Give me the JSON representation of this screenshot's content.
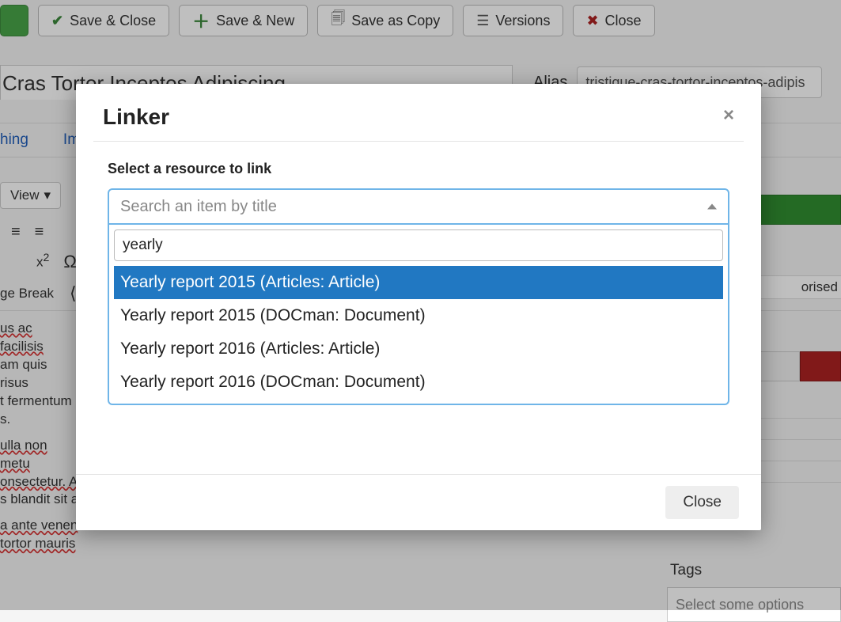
{
  "toolbar": {
    "save_close": "Save & Close",
    "save_new": "Save & New",
    "save_copy": "Save as Copy",
    "versions": "Versions",
    "close": "Close"
  },
  "title_row": {
    "title_value": "Cras Tortor Inceptos Adipiscing",
    "alias_label": "Alias",
    "alias_value": "tristique-cras-tortor-inceptos-adipis"
  },
  "tabs": {
    "partial1": "hing",
    "partial2": "Ima"
  },
  "editor": {
    "view_label": "View",
    "pagebreak": "ge Break",
    "view_caret": "▾"
  },
  "body_text": {
    "p1a": "us ac facilisis",
    "p1b": "am quis risus",
    "p1c": "t fermentum",
    "p1d": "s.",
    "p2a": "ulla non metu",
    "p2b": "onsectetur. A",
    "p2c": "s blandit sit a",
    "p3a": "a ante venen",
    "p3b": "tortor mauris"
  },
  "right_rail": {
    "categorised": "orised",
    "tags_label": "Tags",
    "tags_placeholder": "Select some options"
  },
  "modal": {
    "title": "Linker",
    "select_label": "Select a resource to link",
    "combo_placeholder": "Search an item by title",
    "search_value": "yearly",
    "options": [
      "Yearly report 2015 (Articles: Article)",
      "Yearly report 2015 (DOCman: Document)",
      "Yearly report 2016 (Articles: Article)",
      "Yearly report 2016 (DOCman: Document)"
    ],
    "close_label": "Close"
  }
}
